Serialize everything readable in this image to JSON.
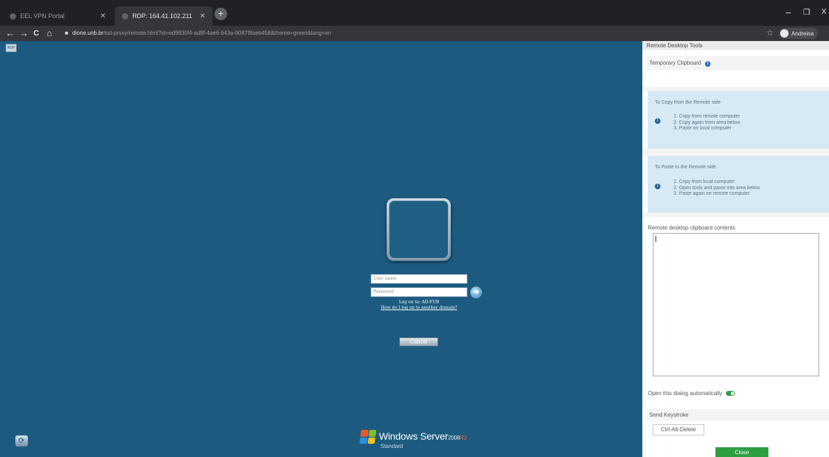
{
  "browser": {
    "tabs": [
      {
        "label": "EEL VPN Portal",
        "active": false
      },
      {
        "label": "RDP: 164.41.102.211",
        "active": true
      }
    ],
    "new_tab_symbol": "+",
    "address": {
      "host": "dione.unb.br",
      "path": "/ssl-proxy/remote.html?id=ed9830f4-ad8f-4ae6-b43a-90879faeb458&theme=green&lang=en"
    },
    "profile_name": "Andreina",
    "window_controls": {
      "minimize": "–",
      "maximize": "❐",
      "close": "X"
    },
    "nav": {
      "back": "←",
      "forward": "→",
      "reload": "C",
      "home": "⌂",
      "lock": "🔒",
      "star": "☆"
    }
  },
  "remote_login": {
    "menu_label": "RDP",
    "username_placeholder": "User name",
    "password_placeholder": "Password",
    "logon_to": "Log on to: AD-FUB",
    "other_domain_link": "How do I log on to another domain?",
    "cancel_label": "Cancel",
    "submit_symbol": "➜",
    "ease_symbol": "⟳",
    "branding": {
      "product": "Windows Server",
      "version": "2008",
      "release": "R2",
      "edition": "Standard"
    },
    "colors": {
      "background": "#1c5b7f",
      "flag": [
        "#e85a2a",
        "#7cbf2f",
        "#2b8fdc",
        "#f5c01a"
      ]
    }
  },
  "tools_panel": {
    "title": "Remote Desktop Tools",
    "temporary_clipboard": "Temporary Clipboard",
    "info_symbol": "i",
    "copy_card": {
      "title": "To Copy from the Remote side",
      "steps": [
        "1. Copy from remote computer",
        "2. Copy again from area below",
        "3. Paste on local computer"
      ]
    },
    "paste_card": {
      "title": "To Paste to the Remote side",
      "steps": [
        "1. Copy from local computer",
        "2. Open tools and paste into area below",
        "3. Paste again on remote computer"
      ]
    },
    "clipboard_label": "Remote desktop clipboard contents",
    "clipboard_value": "",
    "auto_open_label": "Open this dialog automatically",
    "auto_open_enabled": true,
    "send_keystroke": "Send Keystroke",
    "ctrl_alt_delete": "Ctrl-Alt-Delete",
    "close_label": "Close",
    "colors": {
      "accent": "#2f9e41",
      "card": "#d6e9f4"
    }
  }
}
